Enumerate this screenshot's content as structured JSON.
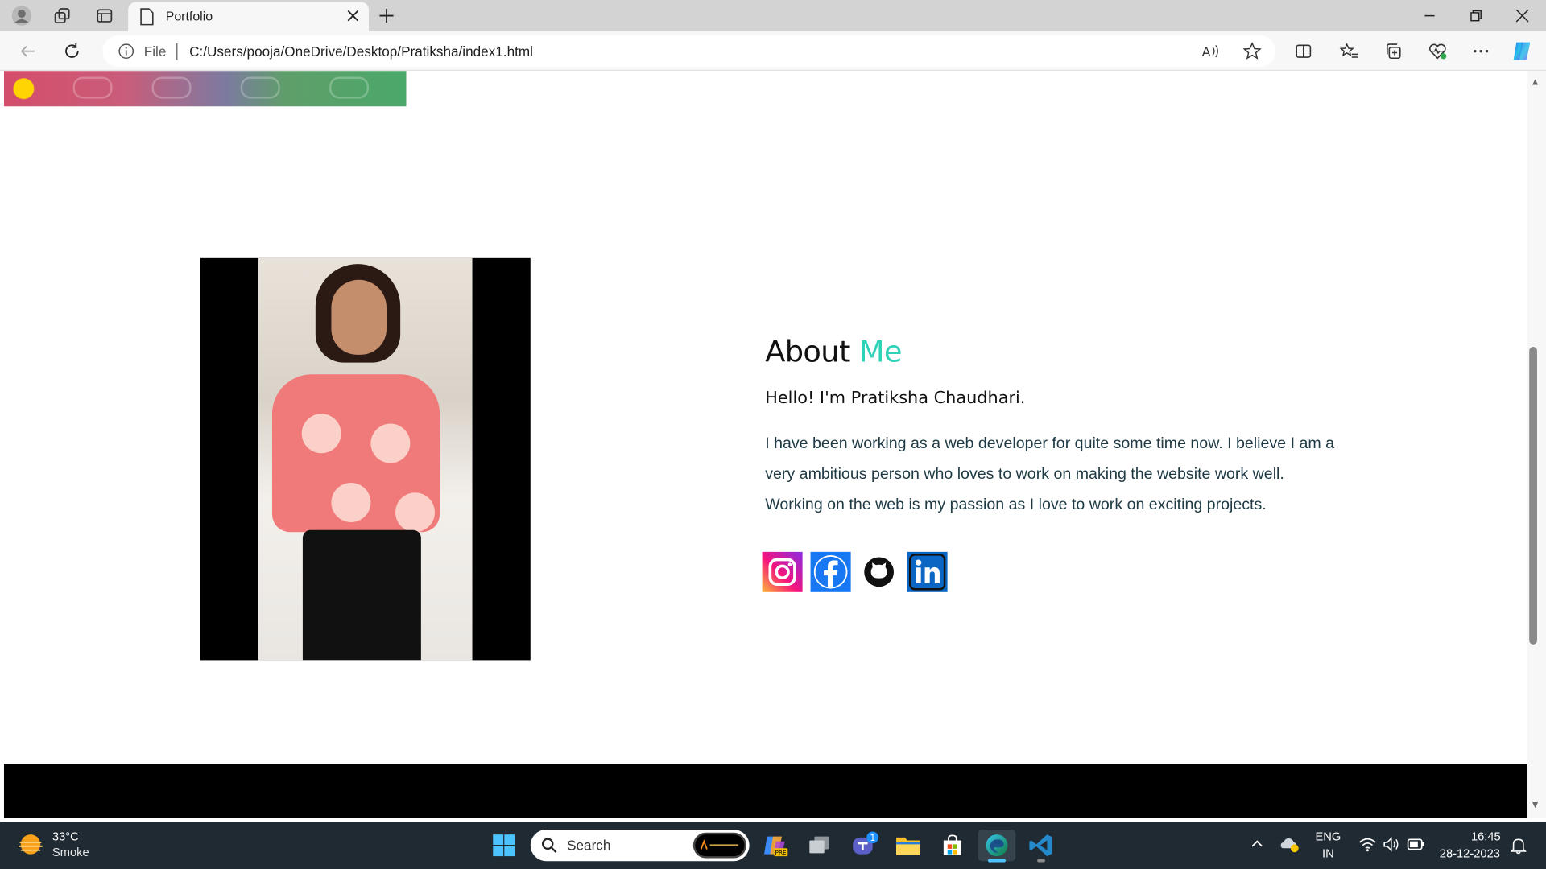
{
  "browser": {
    "tab": {
      "title": "Portfolio"
    },
    "address": {
      "scheme_label": "File",
      "url": "C:/Users/pooja/OneDrive/Desktop/Pratiksha/index1.html"
    }
  },
  "page": {
    "about": {
      "title_main": "About",
      "title_accent": "Me",
      "greeting": "Hello! I'm Pratiksha Chaudhari.",
      "bio_lines": [
        "I have been working as a web developer for quite some time now. I believe I am a",
        "very ambitious person who loves to work on making the website work well.",
        "Working on the web is my passion as I love to work on exciting projects."
      ],
      "socials": [
        "instagram-icon",
        "facebook-icon",
        "github-icon",
        "linkedin-icon"
      ]
    },
    "colors": {
      "accent": "#2ed3b7",
      "footer": "#000000"
    }
  },
  "taskbar": {
    "weather": {
      "temp": "33°C",
      "desc": "Smoke"
    },
    "search_label": "Search",
    "teams_badge": "1",
    "tray": {
      "lang_top": "ENG",
      "lang_bottom": "IN",
      "time": "16:45",
      "date": "28-12-2023"
    }
  }
}
